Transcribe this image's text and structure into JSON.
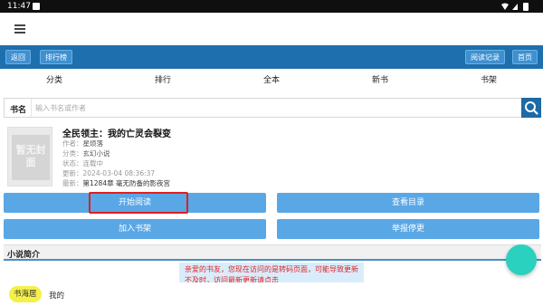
{
  "status_bar": {
    "time": "11:47",
    "icons": [
      "notification-icon",
      "wifi-icon",
      "signal-icon",
      "battery-icon"
    ]
  },
  "app_bar": {
    "menu_icon": "hamburger-menu-icon"
  },
  "blue_bar": {
    "back_label": "返回",
    "ranking_label": "排行榜",
    "history_label": "阅读记录",
    "home_label": "首页",
    "color": "#1d6fad"
  },
  "nav": {
    "items": [
      "分类",
      "排行",
      "全本",
      "新书",
      "书架"
    ]
  },
  "search": {
    "label": "书名",
    "placeholder": "输入书名或作者",
    "button_icon": "search-icon"
  },
  "book": {
    "title": "全民领主：我的亡灵会裂变",
    "cover_text": "暂无封面",
    "author_key": "作者：",
    "author": "星烦落",
    "category_key": "分类：",
    "category": "玄幻小说",
    "status_key": "状态：",
    "status": "连载中",
    "updated_key": "更新：",
    "updated": "2024-03-04 08:36:37",
    "latest_key": "最新：",
    "latest": "第1284章 毫无防备的影夜宫"
  },
  "actions": {
    "start_reading": "开始阅读",
    "view_catalog": "查看目录",
    "add_shelf": "加入书架",
    "report": "举报停更",
    "button_color": "#5aa7e6",
    "highlight_color": "#e01f1f"
  },
  "intro": {
    "heading": "小说简介"
  },
  "notice": {
    "text": "亲爱的书友，您现在访问的是转码页面，可能导致更新不及时，访问最新更新请点击"
  },
  "bottom_nav": {
    "tab1": "书海居",
    "tab2": "我的",
    "tab1_color": "#f4f04a"
  },
  "fab": {
    "color": "#2ad1bf"
  }
}
